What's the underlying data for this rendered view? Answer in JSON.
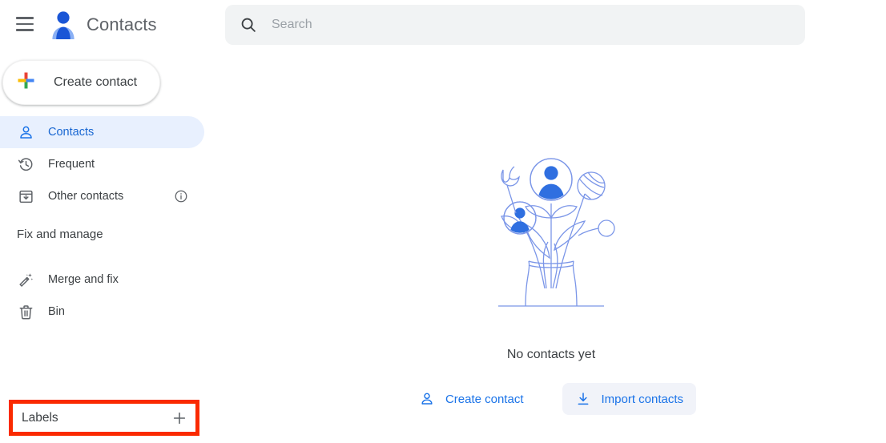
{
  "app": {
    "title": "Contacts",
    "logo_icon": "contacts-person-logo",
    "menu_icon": "hamburger-menu-icon"
  },
  "search": {
    "placeholder": "Search",
    "value": "",
    "icon": "search-icon"
  },
  "sidebar": {
    "create_button": {
      "label": "Create contact",
      "icon": "google-plus-icon"
    },
    "primary_items": [
      {
        "label": "Contacts",
        "icon": "person-outline-icon",
        "selected": true,
        "trailing_icon": null
      },
      {
        "label": "Frequent",
        "icon": "history-clock-icon",
        "selected": false,
        "trailing_icon": null
      },
      {
        "label": "Other contacts",
        "icon": "archive-down-icon",
        "selected": false,
        "trailing_icon": "info-icon"
      }
    ],
    "fix_and_manage": {
      "heading": "Fix and manage",
      "items": [
        {
          "label": "Merge and fix",
          "icon": "magic-wand-icon"
        },
        {
          "label": "Bin",
          "icon": "trash-bin-icon"
        }
      ]
    },
    "labels": {
      "heading": "Labels",
      "add_icon": "plus-icon",
      "highlighted": true,
      "highlight_color": "#fa2a00"
    }
  },
  "main": {
    "empty_state": {
      "illustration": "flowers-in-vase-with-contact-avatars",
      "title": "No contacts yet",
      "actions": [
        {
          "label": "Create contact",
          "icon": "person-add-icon",
          "style": "text"
        },
        {
          "label": "Import contacts",
          "icon": "download-import-icon",
          "style": "filled"
        }
      ]
    }
  },
  "colors": {
    "accent_blue": "#1a73e8",
    "selected_bg": "#e8f0fe",
    "search_bg": "#f1f3f4",
    "text_primary": "#3c4043",
    "text_muted": "#5f6368",
    "illustration_blue": "#7b96e8",
    "avatar_blue": "#2f6fe0",
    "google_red": "#ea4335",
    "google_yellow": "#fbbc04",
    "google_green": "#34a853",
    "google_blue": "#4285f4"
  }
}
